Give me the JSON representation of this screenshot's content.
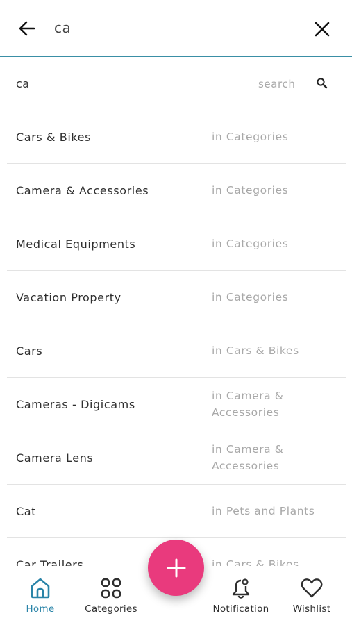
{
  "header": {
    "query": "ca"
  },
  "search_row": {
    "query": "ca",
    "search_label": "search"
  },
  "results": [
    {
      "name": "Cars & Bikes",
      "context": "in Categories"
    },
    {
      "name": "Camera & Accessories",
      "context": "in Categories"
    },
    {
      "name": "Medical Equipments",
      "context": "in Categories"
    },
    {
      "name": "Vacation Property",
      "context": "in Categories"
    },
    {
      "name": "Cars",
      "context": "in Cars & Bikes"
    },
    {
      "name": "Cameras - Digicams",
      "context": "in Camera & Accessories"
    },
    {
      "name": "Camera Lens",
      "context": "in Camera & Accessories"
    },
    {
      "name": "Cat",
      "context": "in Pets and Plants"
    },
    {
      "name": "Car Trailers",
      "context": "in Cars & Bikes"
    }
  ],
  "nav": {
    "home": "Home",
    "categories": "Categories",
    "notification": "Notification",
    "wishlist": "Wishlist"
  },
  "icons": {
    "back": "arrow-left-icon",
    "close": "close-icon",
    "search": "search-icon",
    "add": "plus-icon",
    "home": "home-icon",
    "categories": "grid-icon",
    "notification": "bell-icon",
    "wishlist": "heart-icon"
  },
  "colors": {
    "accent": "#2a84a8",
    "fab": "#e93a7d",
    "divider": "#e3e3e3"
  }
}
